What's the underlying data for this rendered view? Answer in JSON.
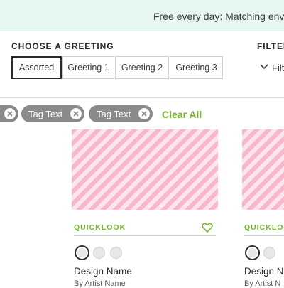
{
  "banner": {
    "text": "Free every day: Matching enve"
  },
  "greeting": {
    "title": "CHOOSE A GREETING",
    "options": [
      {
        "label": "Assorted",
        "selected": true
      },
      {
        "label": "Greeting 1",
        "selected": false
      },
      {
        "label": "Greeting 2",
        "selected": false
      },
      {
        "label": "Greeting 3",
        "selected": false
      }
    ]
  },
  "filter": {
    "title": "FILTER",
    "toggle_label": "Filt"
  },
  "tags": {
    "items": [
      {
        "label": "Tag Text"
      },
      {
        "label": "Tag Text"
      },
      {
        "label": "Tag Text"
      }
    ],
    "clear_label": "Clear All"
  },
  "cards": [
    {
      "quicklook": "QUICKLOOK",
      "design_name": "Design Name",
      "artist": "By Artist Name"
    },
    {
      "quicklook": "QUICKLOOK",
      "design_name": "Design Na",
      "artist": "By Artist N"
    }
  ],
  "colors": {
    "accent_green": "#79b52c",
    "tag_gray": "#8a8a8a",
    "banner_mint": "#e6f7f1",
    "stripe_pink": "#f7b8cf"
  }
}
